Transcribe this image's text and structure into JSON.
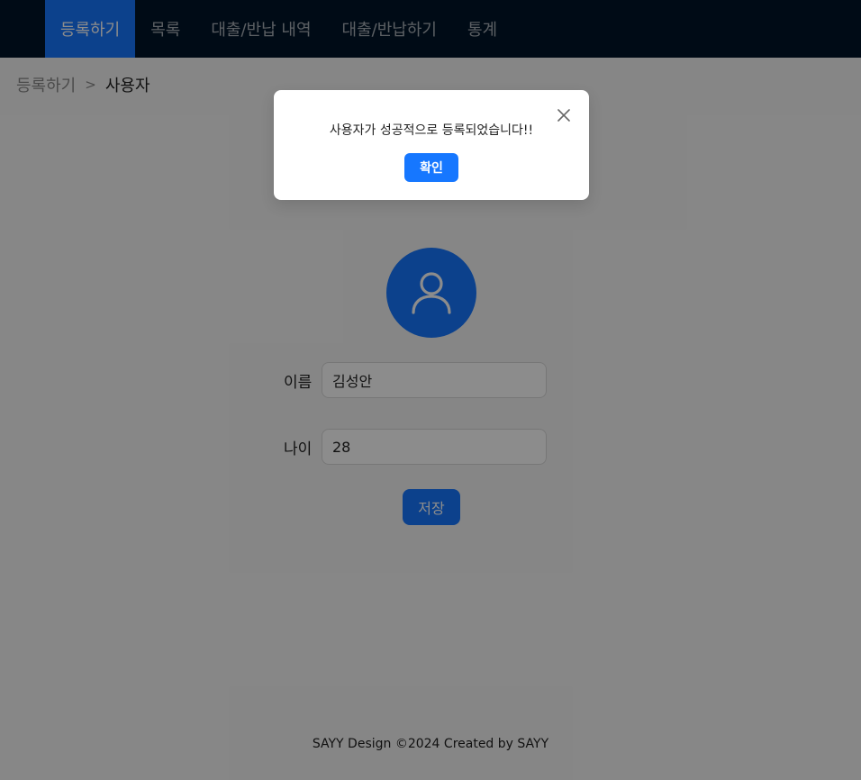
{
  "nav": {
    "items": [
      {
        "label": "등록하기",
        "active": true
      },
      {
        "label": "목록",
        "active": false
      },
      {
        "label": "대출/반납 내역",
        "active": false
      },
      {
        "label": "대출/반납하기",
        "active": false
      },
      {
        "label": "통계",
        "active": false
      }
    ]
  },
  "breadcrumb": {
    "parent": "등록하기",
    "separator": ">",
    "current": "사용자"
  },
  "avatar": {
    "icon": "user-icon"
  },
  "form": {
    "name_label": "이름",
    "name_value": "김성안",
    "age_label": "나이",
    "age_value": "28",
    "save_label": "저장"
  },
  "footer": {
    "text": "SAYY Design ©2024 Created by SAYY"
  },
  "modal": {
    "message": "사용자가 성공적으로 등록되었습니다!!",
    "ok_label": "확인",
    "close_icon": "close-icon"
  },
  "colors": {
    "primary": "#1677ff",
    "header": "#001529",
    "background": "#f5f5f5"
  }
}
